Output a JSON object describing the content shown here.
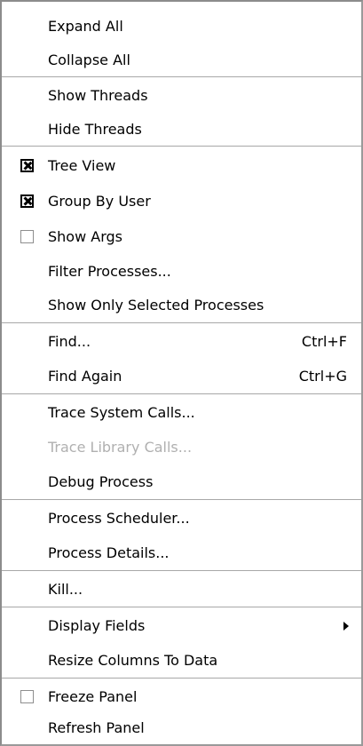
{
  "menu": {
    "expand_all": "Expand All",
    "collapse_all": "Collapse All",
    "show_threads": "Show Threads",
    "hide_threads": "Hide Threads",
    "tree_view": "Tree View",
    "tree_view_checked": true,
    "group_by_user": "Group By User",
    "group_by_user_checked": true,
    "show_args": "Show Args",
    "show_args_checked": false,
    "filter_processes": "Filter Processes...",
    "show_only_selected": "Show Only Selected Processes",
    "find": "Find...",
    "find_shortcut": "Ctrl+F",
    "find_again": "Find Again",
    "find_again_shortcut": "Ctrl+G",
    "trace_system_calls": "Trace System Calls...",
    "trace_library_calls": "Trace Library Calls...",
    "debug_process": "Debug Process",
    "process_scheduler": "Process Scheduler...",
    "process_details": "Process Details...",
    "kill": "Kill...",
    "display_fields": "Display Fields",
    "resize_columns": "Resize Columns To Data",
    "freeze_panel": "Freeze Panel",
    "freeze_panel_checked": false,
    "refresh_panel": "Refresh Panel"
  }
}
